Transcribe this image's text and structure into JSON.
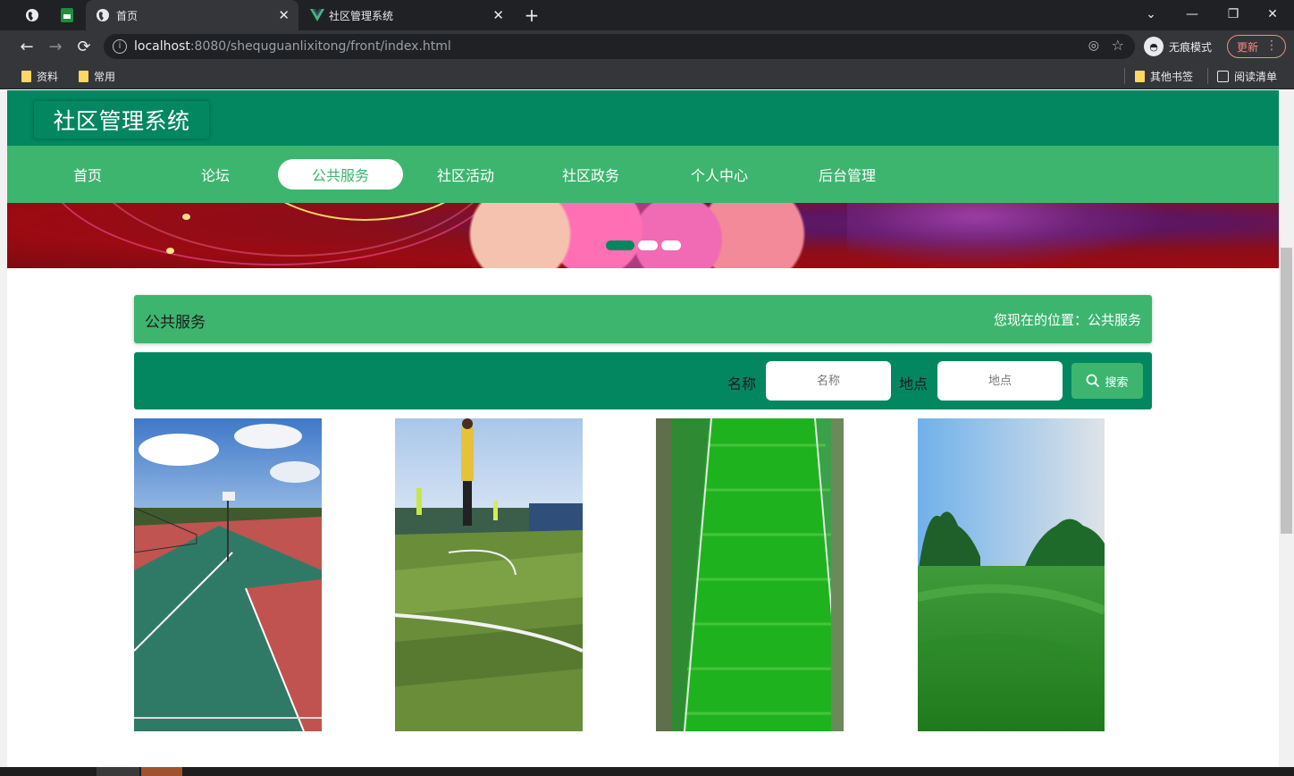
{
  "browser": {
    "tabs": [
      {
        "title": "首页",
        "active": true
      },
      {
        "title": "社区管理系统",
        "active": false
      }
    ],
    "new_tab": "+",
    "url_host": "localhost",
    "url_rest": ":8080/shequguanlixitong/front/index.html",
    "incognito_label": "无痕模式",
    "update_label": "更新",
    "bookmarks_left": [
      "资料",
      "常用"
    ],
    "bookmarks_right": [
      "其他书签",
      "阅读清单"
    ]
  },
  "site": {
    "logo": "社区管理系统",
    "nav": [
      "首页",
      "论坛",
      "公共服务",
      "社区活动",
      "社区政务",
      "个人中心",
      "后台管理"
    ],
    "active_nav": "公共服务"
  },
  "section": {
    "title": "公共服务",
    "location": "您现在的位置：公共服务"
  },
  "search": {
    "name_label": "名称",
    "name_placeholder": "名称",
    "place_label": "地点",
    "place_placeholder": "地点",
    "button": "搜索"
  },
  "cards": [
    {
      "image": "basketball-court-photo"
    },
    {
      "image": "football-field-photo"
    },
    {
      "image": "aerial-football-pitch-photo"
    },
    {
      "image": "golf-lawn-photo"
    }
  ],
  "colors": {
    "header": "#028760",
    "nav": "#3db56f"
  }
}
